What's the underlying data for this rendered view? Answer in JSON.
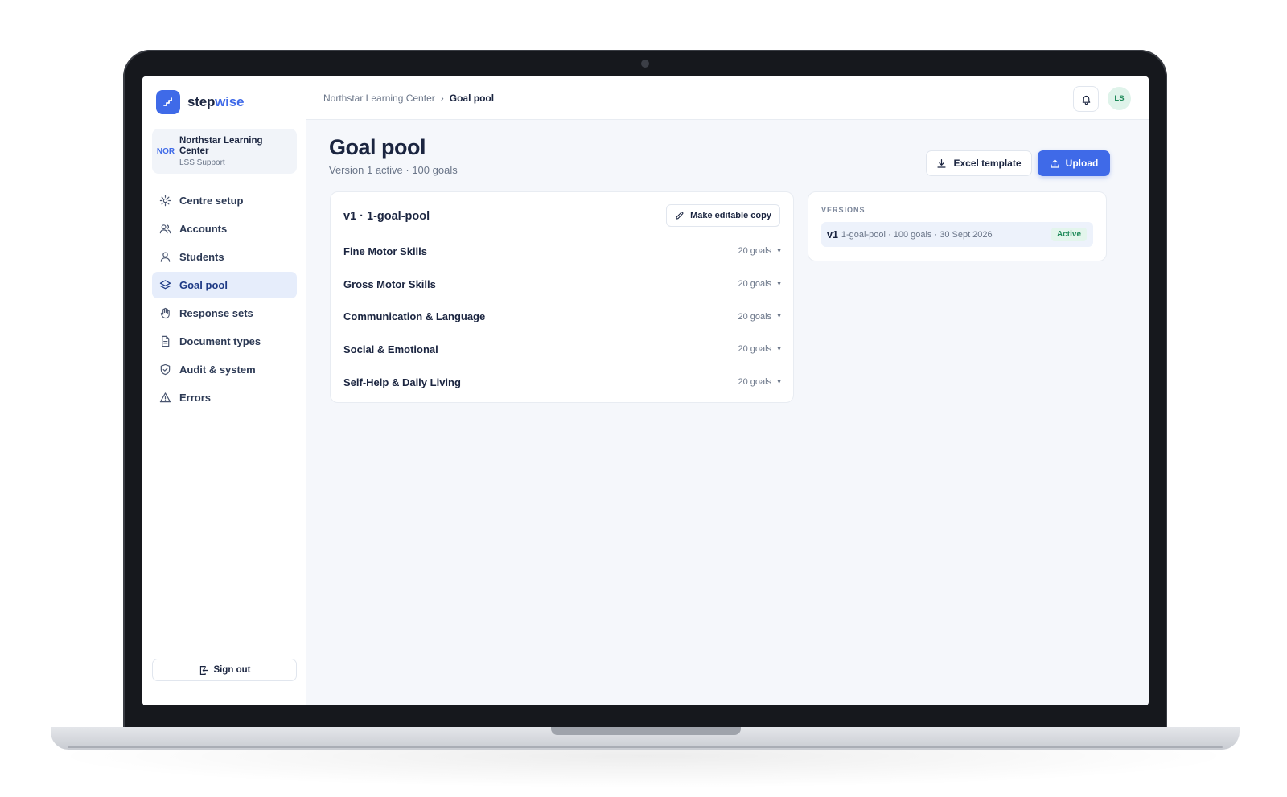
{
  "brand": {
    "name_part1": "step",
    "name_part2": "wise",
    "accent_color": "#3f6ae8"
  },
  "org": {
    "code": "NOR",
    "name": "Northstar Learning Center",
    "role": "LSS Support"
  },
  "nav": {
    "items": [
      {
        "label": "Centre setup",
        "icon": "gear-icon"
      },
      {
        "label": "Accounts",
        "icon": "users-icon"
      },
      {
        "label": "Students",
        "icon": "user-icon"
      },
      {
        "label": "Goal pool",
        "icon": "layers-icon",
        "active": true
      },
      {
        "label": "Response sets",
        "icon": "hand-icon"
      },
      {
        "label": "Document types",
        "icon": "document-icon"
      },
      {
        "label": "Audit & system",
        "icon": "shield-icon"
      },
      {
        "label": "Errors",
        "icon": "warning-icon"
      }
    ],
    "signout_label": "Sign out"
  },
  "topbar": {
    "breadcrumb_root": "Northstar Learning Center",
    "breadcrumb_separator": "›",
    "breadcrumb_current": "Goal pool",
    "avatar_initials": "LS"
  },
  "page": {
    "title": "Goal pool",
    "subtitle": "Version 1 active · 100 goals",
    "excel_button": "Excel template",
    "upload_button": "Upload"
  },
  "pool": {
    "title": "v1 · 1-goal-pool",
    "copy_button": "Make editable copy",
    "domains": [
      {
        "name": "Fine Motor Skills",
        "count": "20 goals"
      },
      {
        "name": "Gross Motor Skills",
        "count": "20 goals"
      },
      {
        "name": "Communication & Language",
        "count": "20 goals"
      },
      {
        "name": "Social & Emotional",
        "count": "20 goals"
      },
      {
        "name": "Self-Help & Daily Living",
        "count": "20 goals"
      }
    ]
  },
  "versions": {
    "heading": "VERSIONS",
    "items": [
      {
        "id": "v1",
        "meta": "1-goal-pool · 100 goals · 30 Sept 2026",
        "status": "Active"
      }
    ]
  }
}
